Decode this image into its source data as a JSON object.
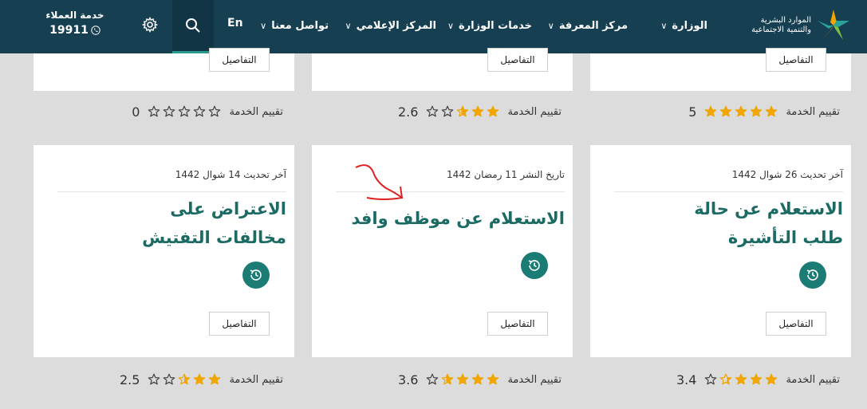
{
  "header": {
    "logo_line1": "الموارد البشرية",
    "logo_line2": "والتنمية الاجتماعية",
    "nav": [
      {
        "label": "الوزارة"
      },
      {
        "label": "مركز المعرفة"
      },
      {
        "label": "خدمات الوزارة"
      },
      {
        "label": "المركز الإعلامي"
      },
      {
        "label": "تواصل معنا"
      }
    ],
    "lang": "En",
    "customer_service_title": "خدمة العملاء",
    "customer_service_number": "19911",
    "icons": {
      "search": "search-icon",
      "settings": "gear-icon",
      "phone": "phone-icon"
    },
    "colors": {
      "bg": "#173f52",
      "accent": "#2a9a8f"
    }
  },
  "top_row": [
    {
      "details": "التفاصيل",
      "rating_label": "تقييم الخدمة",
      "rating_value": "0",
      "rating": 0
    },
    {
      "details": "التفاصيل",
      "rating_label": "تقييم الخدمة",
      "rating_value": "2.6",
      "rating": 2.6
    },
    {
      "details": "التفاصيل",
      "rating_label": "تقييم الخدمة",
      "rating_value": "5",
      "rating": 5
    }
  ],
  "cards": [
    {
      "meta": "آخر تحديث 14 شوال 1442",
      "title": "الاعتراض على مخالفات التفتيش",
      "details": "التفاصيل",
      "rating_label": "تقييم الخدمة",
      "rating_value": "2.5",
      "rating": 2.5
    },
    {
      "meta": "تاريخ النشر 11 رمضان 1442",
      "title": "الاستعلام عن موظف وافد",
      "details": "التفاصيل",
      "rating_label": "تقييم الخدمة",
      "rating_value": "3.6",
      "rating": 3.6
    },
    {
      "meta": "آخر تحديث 26 شوال 1442",
      "title": "الاستعلام عن حالة طلب التأشيرة",
      "details": "التفاصيل",
      "rating_label": "تقييم الخدمة",
      "rating_value": "3.4",
      "rating": 3.4
    }
  ],
  "colors": {
    "title": "#1b6b64",
    "star": "#f0a500",
    "history_btn": "#1a7c74"
  }
}
